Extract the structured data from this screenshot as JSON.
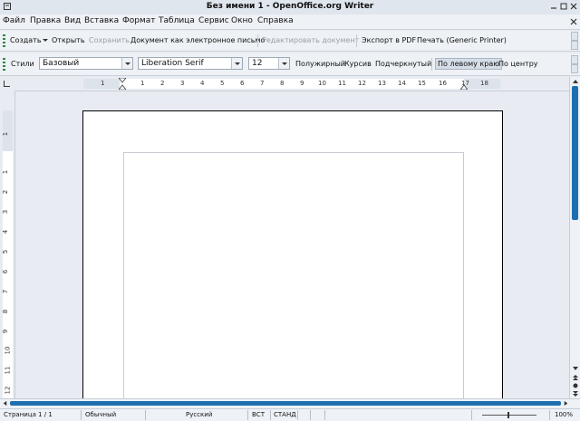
{
  "window": {
    "title": "Без имени 1 - OpenOffice.org Writer"
  },
  "menubar": {
    "items": [
      "Файл",
      "Правка",
      "Вид",
      "Вставка",
      "Формат",
      "Таблица",
      "Сервис",
      "Окно",
      "Справка"
    ]
  },
  "toolbar_standard": {
    "new_label": "Создать",
    "open_label": "Открыть",
    "save_label": "Сохранить",
    "email_label": "Документ как электронное письмо",
    "edit_label": "Редактировать документ",
    "pdf_label": "Экспорт в PDF",
    "print_label": "Печать (Generic Printer)"
  },
  "toolbar_formatting": {
    "styles_label": "Стили",
    "paragraph_style": "Базовый",
    "font_name": "Liberation Serif",
    "font_size": "12",
    "bold_label": "Полужирный",
    "italic_label": "Курсив",
    "underline_label": "Подчеркнутый",
    "align_left_label": "По левому краю",
    "align_center_label": "По центру"
  },
  "ruler": {
    "h_numbers": [
      "1",
      "1",
      "2",
      "3",
      "4",
      "5",
      "6",
      "7",
      "8",
      "9",
      "10",
      "11",
      "12",
      "13",
      "14",
      "15",
      "16",
      "17",
      "18"
    ],
    "v_numbers": [
      "1",
      "1",
      "2",
      "3",
      "4",
      "5",
      "6",
      "7",
      "8",
      "9",
      "10",
      "11",
      "12"
    ]
  },
  "statusbar": {
    "page": "Страница  1 / 1",
    "page_style": "Обычный",
    "language": "Русский",
    "insert_mode": "ВСТ",
    "selection_mode": "СТАНД",
    "zoom": "100%"
  },
  "colors": {
    "accent": "#1e6fb0",
    "grip": "#2d8a3e"
  }
}
